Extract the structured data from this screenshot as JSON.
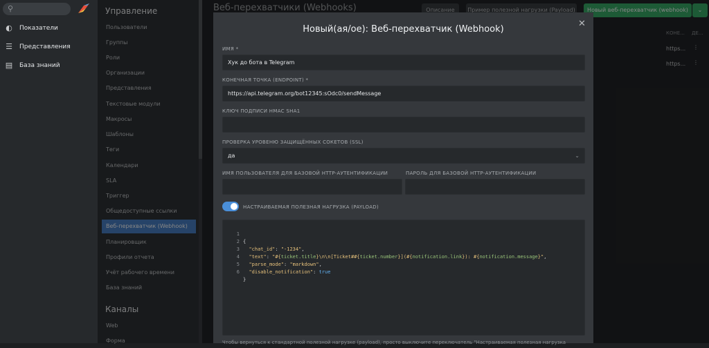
{
  "nav": {
    "items": [
      {
        "label": "Показатели",
        "icon": "dashboard-icon"
      },
      {
        "label": "Представления",
        "icon": "list-icon"
      },
      {
        "label": "База знаний",
        "icon": "book-icon"
      }
    ]
  },
  "menu": {
    "section1": "Управление",
    "items": [
      "Пользователи",
      "Группы",
      "Роли",
      "Организации",
      "Представления",
      "Текстовые модули",
      "Макросы",
      "Шаблоны",
      "Теги",
      "Календари",
      "SLA",
      "Триггер",
      "Общедоступные ссылки",
      "Веб-перехватчик (Webhook)",
      "Планировщик",
      "Профили отчета",
      "Учёт рабочего времени",
      "База знаний"
    ],
    "active_index": 13,
    "section2": "Каналы",
    "channels": [
      "Web",
      "Форма"
    ]
  },
  "content": {
    "title": "Веб-перехватчики (Webhooks)",
    "btn_description": "Описание",
    "btn_example": "Пример полезной нагрузки (Payload)",
    "btn_new": "Новый веб-перехватчик (webhook)",
    "col_endpoint": "КОНЕ...",
    "col_extra": "ДЕ...",
    "rows": [
      "https...",
      "https..."
    ]
  },
  "modal": {
    "title": "Новый(ая/ое): Веб-перехватчик (Webhook)",
    "name_label": "ИМЯ *",
    "name_value": "Хук до бота в Telegram",
    "endpoint_label": "КОНЕЧНАЯ ТОЧКА (ENDPOINT) *",
    "endpoint_value": "https://api.telegram.org/bot12345:sOdc0/sendMessage",
    "hmac_label": "КЛЮЧ ПОДПИСИ HMAC SHA1",
    "hmac_value": "",
    "ssl_label": "ПРОВЕРКА УРОВЕНЮ ЗАЩИЩЁННЫХ СОКЕТОВ (SSL)",
    "ssl_value": "да",
    "user_label": "ИМЯ ПОЛЬЗОВАТЕЛЯ ДЛЯ БАЗОВОЙ HTTP-АУТЕНТИФИКАЦИИ",
    "user_value": "",
    "pass_label": "ПАРОЛЬ ДЛЯ БАЗОВОЙ HTTP-АУТЕНТИФИКАЦИИ",
    "pass_value": "",
    "payload_toggle_label": "НАСТРАИВАЕМАЯ ПОЛЕЗНАЯ НАГРУЗКА (PAYLOAD)",
    "payload_enabled": true,
    "code_line_numbers": [
      "1",
      "2",
      "3",
      "4",
      "5",
      "6"
    ],
    "code": {
      "open": "{",
      "k1": "\"chat_id\"",
      "v1": "\"-1234\"",
      "k2": "\"text\"",
      "v2a": "\"#{",
      "v2b": "ticket.title",
      "v2c": "}",
      "v2d": "\\n\\n[Ticket#",
      "v2e": "#{",
      "v2f": "ticket.number",
      "v2g": "}",
      "v2h": "](#{",
      "v2i": "notification.link",
      "v2j": "}): ",
      "v2k": "#{",
      "v2l": "notification.message",
      "v2m": "}\"",
      "k3": "\"parse_mode\"",
      "v3": "\"markdown\"",
      "k4": "\"disable_notification\"",
      "v4": "true",
      "close": "}"
    },
    "footnote": "Чтобы вернуться к стандартной полезной нагрузке (payload), просто выключите переключатель \"Настраиваемая полезная нагрузка"
  }
}
